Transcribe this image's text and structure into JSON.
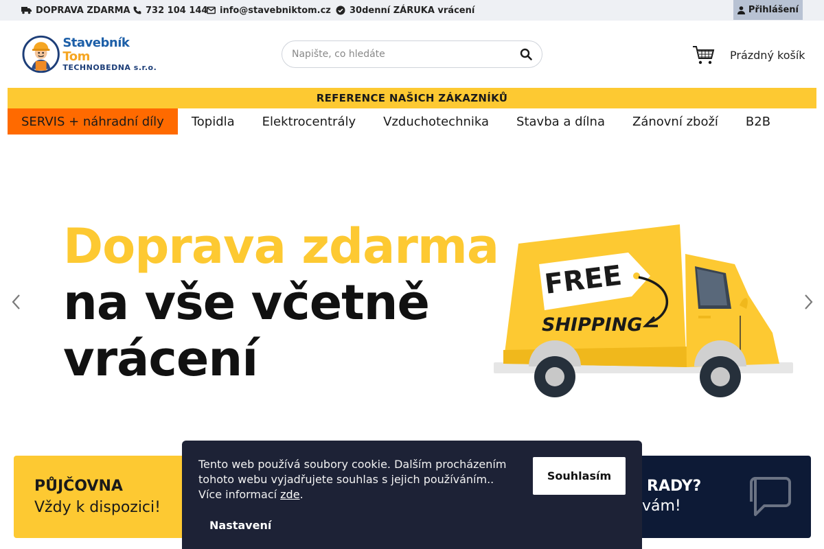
{
  "topbar": {
    "shipping": "DOPRAVA ZDARMA",
    "phone": "732 104 144",
    "email": "info@stavebniktom.cz",
    "warranty": "30denní ZÁRUKA vrácení",
    "login": "Přihlášení"
  },
  "header": {
    "logo_name_1": "Stavebník",
    "logo_name_2": "Tom",
    "logo_sub": "TECHNOBEDNA s.r.o.",
    "search_placeholder": "Napište, co hledáte",
    "cart_label": "Prázdný košík"
  },
  "reference_banner": "REFERENCE NAŠICH ZÁKAZNÍKŮ",
  "nav": {
    "items": [
      "SERVIS + náhradní díly",
      "Topidla",
      "Elektrocentrály",
      "Vzduchotechnika",
      "Stavba a dílna",
      "Zánovní zboží",
      "B2B"
    ]
  },
  "hero": {
    "line1": "Doprava zdarma",
    "line2": "na vše včetně",
    "line3": "vrácení",
    "truck_tag_1": "FREE",
    "truck_tag_2": "SHIPPING"
  },
  "cards": {
    "rental_title": "PŮJČOVNA",
    "rental_sub": "Vždy k dispozici!",
    "advice_title": "RADY?",
    "advice_sub": "vám!"
  },
  "cookie": {
    "text": "Tento web používá soubory cookie. Dalším procházením tohoto webu vyjadřujete souhlas s jejich používáním.. Více informací",
    "link": "zde",
    "accept": "Souhlasím",
    "settings": "Nastavení"
  },
  "colors": {
    "brand_yellow": "#fdc932",
    "nav_active": "#ff6a00",
    "dark_navy": "#0d1a36",
    "cookie_bg": "#1d2236"
  }
}
